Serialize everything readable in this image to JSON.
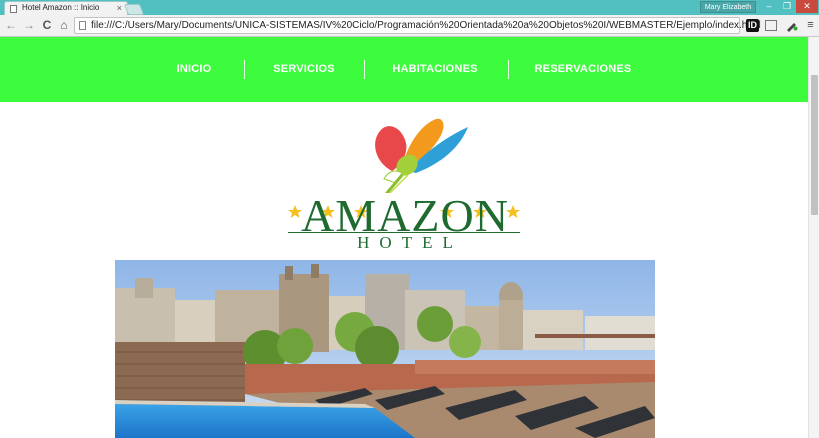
{
  "browser": {
    "tab_title": "Hotel Amazon :: Inicio",
    "tab_close": "×",
    "user_name": "Mary Elizabeth",
    "url": "file:///C:/Users/Mary/Documents/UNICA-SISTEMAS/IV%20Ciclo/Programación%20Orientada%20a%20Objetos%20I/WEBMASTER/Ejemplo/index.html",
    "window_buttons": {
      "minimize": "–",
      "maximize": "❐",
      "close": "✕"
    },
    "nav_glyphs": {
      "back": "←",
      "forward": "→",
      "reload": "C",
      "home": "⌂"
    },
    "extensions": {
      "id_badge": "ID",
      "menu": "≡"
    }
  },
  "site": {
    "nav": {
      "items": [
        {
          "label": "Inicio"
        },
        {
          "label": "Servicios"
        },
        {
          "label": "Habitaciones"
        },
        {
          "label": "Reservaciones"
        }
      ]
    },
    "logo": {
      "name": "AMAZON",
      "subtitle": "HOTEL",
      "star_count": 6
    }
  },
  "colors": {
    "nav_background": "#3dfc3d",
    "logo_green": "#1f6b2f",
    "star_yellow": "#f4c01e",
    "titlebar": "#52c0c0"
  }
}
